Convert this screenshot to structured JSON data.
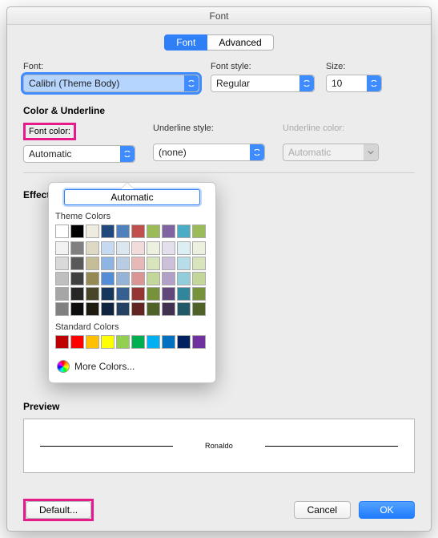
{
  "title": "Font",
  "tabs": {
    "font": "Font",
    "advanced": "Advanced"
  },
  "labels": {
    "font": "Font:",
    "fontStyle": "Font style:",
    "size": "Size:",
    "colorUnderline": "Color & Underline",
    "fontColor": "Font color:",
    "underlineStyle": "Underline style:",
    "underlineColor": "Underline color:",
    "effects": "Effects",
    "preview": "Preview"
  },
  "values": {
    "font": "Calibri (Theme Body)",
    "fontStyle": "Regular",
    "size": "10",
    "fontColor": "Automatic",
    "underlineStyle": "(none)",
    "underlineColor": "Automatic"
  },
  "popover": {
    "automatic": "Automatic",
    "themeColors": "Theme Colors",
    "standardColors": "Standard Colors",
    "moreColors": "More Colors...",
    "theme_row0": [
      "#ffffff",
      "#000000",
      "#eeece1",
      "#1f497d",
      "#4f81bd",
      "#c0504d",
      "#9bbb59",
      "#8064a2",
      "#4bacc6",
      "#9bbb59"
    ],
    "theme_shades": [
      [
        "#f2f2f2",
        "#808080",
        "#ddd9c4",
        "#c5d9f1",
        "#dce6f1",
        "#f2dcdb",
        "#ebf1de",
        "#e4dfec",
        "#daeef3",
        "#ebf1de"
      ],
      [
        "#d9d9d9",
        "#595959",
        "#c4bd97",
        "#8db4e2",
        "#b8cce4",
        "#e6b8b7",
        "#d8e4bc",
        "#ccc0da",
        "#b7dee8",
        "#d8e4bc"
      ],
      [
        "#bfbfbf",
        "#404040",
        "#948a54",
        "#538dd5",
        "#95b3d7",
        "#da9694",
        "#c4d79b",
        "#b1a0c7",
        "#92cddc",
        "#c4d79b"
      ],
      [
        "#a6a6a6",
        "#262626",
        "#494529",
        "#16365c",
        "#366092",
        "#963634",
        "#76933c",
        "#60497a",
        "#31869b",
        "#76933c"
      ],
      [
        "#808080",
        "#0d0d0d",
        "#1d1b10",
        "#0f243e",
        "#244062",
        "#632523",
        "#4f6228",
        "#403151",
        "#215967",
        "#4f6228"
      ]
    ],
    "standard": [
      "#c00000",
      "#ff0000",
      "#ffc000",
      "#ffff00",
      "#92d050",
      "#00b050",
      "#00b0f0",
      "#0070c0",
      "#002060",
      "#7030a0"
    ]
  },
  "preview": {
    "text": "Ronaldo"
  },
  "buttons": {
    "default": "Default...",
    "cancel": "Cancel",
    "ok": "OK"
  }
}
